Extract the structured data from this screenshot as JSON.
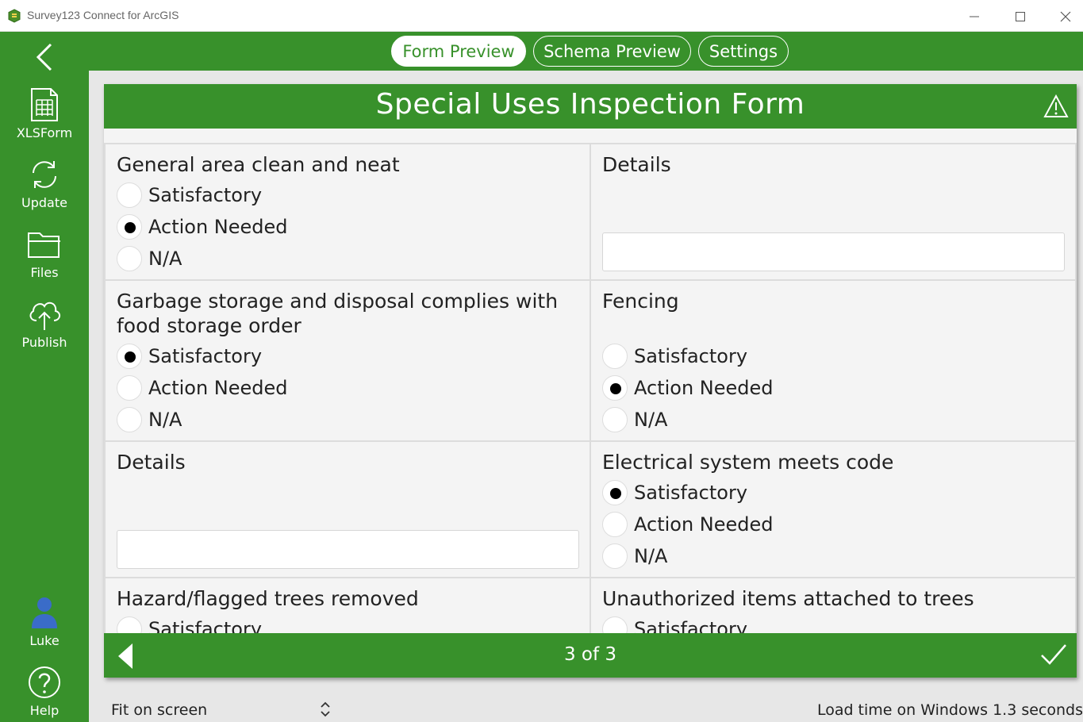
{
  "window": {
    "title": "Survey123 Connect for ArcGIS"
  },
  "sidebar": {
    "items": [
      {
        "label": "XLSForm",
        "icon": "spreadsheet-icon"
      },
      {
        "label": "Update",
        "icon": "refresh-icon"
      },
      {
        "label": "Files",
        "icon": "folder-icon"
      },
      {
        "label": "Publish",
        "icon": "cloud-upload-icon"
      }
    ],
    "user": {
      "label": "Luke",
      "icon": "user-icon"
    },
    "help": {
      "label": "Help",
      "icon": "help-icon"
    }
  },
  "tabs": [
    {
      "label": "Form Preview",
      "active": true
    },
    {
      "label": "Schema Preview",
      "active": false
    },
    {
      "label": "Settings",
      "active": false
    }
  ],
  "form": {
    "title": "Special Uses Inspection Form",
    "questions": {
      "general_area": {
        "label": "General area clean and neat",
        "options": [
          "Satisfactory",
          "Action Needed",
          "N/A"
        ],
        "selected": "Action Needed"
      },
      "details_1": {
        "label": "Details",
        "value": ""
      },
      "garbage": {
        "label": "Garbage storage and disposal complies with food storage order",
        "options": [
          "Satisfactory",
          "Action Needed",
          "N/A"
        ],
        "selected": "Satisfactory"
      },
      "fencing": {
        "label": "Fencing",
        "options": [
          "Satisfactory",
          "Action Needed",
          "N/A"
        ],
        "selected": "Action Needed"
      },
      "details_2": {
        "label": "Details",
        "value": ""
      },
      "electrical": {
        "label": "Electrical system meets code",
        "options": [
          "Satisfactory",
          "Action Needed",
          "N/A"
        ],
        "selected": "Satisfactory"
      },
      "hazard_trees": {
        "label": "Hazard/flagged trees removed",
        "options": [
          "Satisfactory"
        ]
      },
      "unauthorized": {
        "label": "Unauthorized items attached to trees",
        "options": [
          "Satisfactory"
        ]
      }
    },
    "page_indicator": "3 of 3"
  },
  "status": {
    "fit": "Fit on screen",
    "load_time": "Load time on Windows 1.3 seconds"
  },
  "colors": {
    "brand_green": "#38912b",
    "stage_gray": "#e7e7e7"
  }
}
